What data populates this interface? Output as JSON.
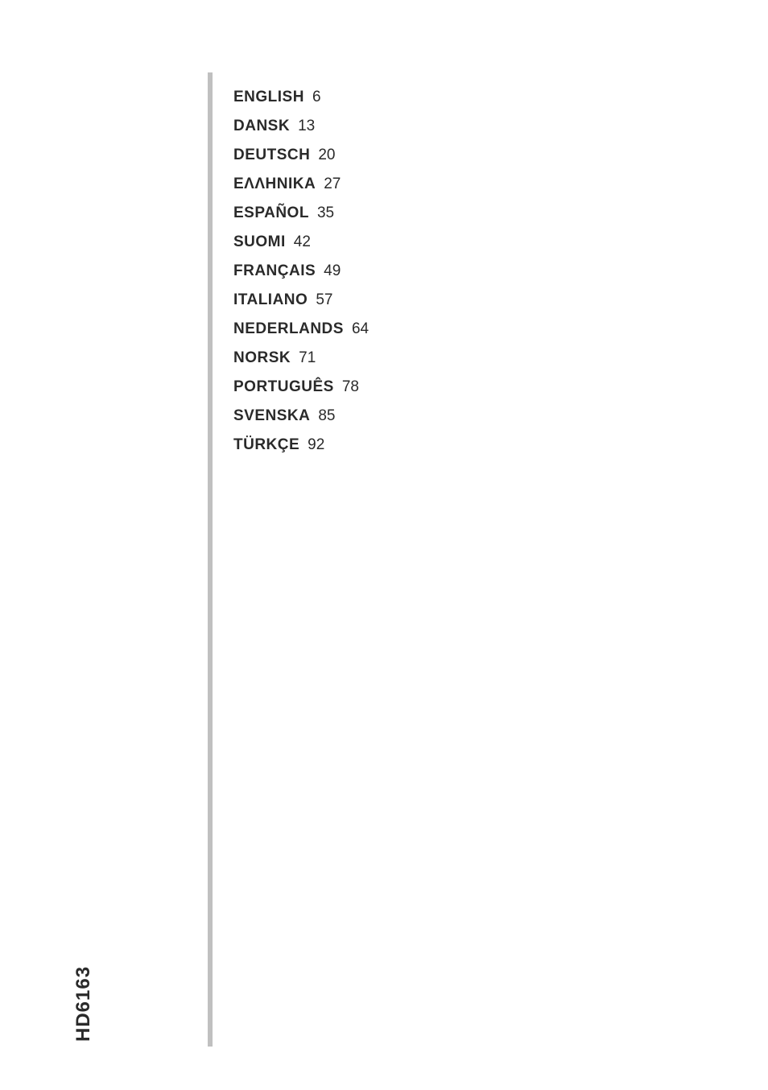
{
  "modelNumber": "HD6163",
  "languages": [
    {
      "name": "ENGLISH",
      "page": "6"
    },
    {
      "name": "DANSK",
      "page": "13"
    },
    {
      "name": "DEUTSCH",
      "page": "20"
    },
    {
      "name": "ΕΛΛΗΝΙΚΑ",
      "page": "27"
    },
    {
      "name": "ESPAÑOL",
      "page": "35"
    },
    {
      "name": "SUOMI",
      "page": "42"
    },
    {
      "name": "FRANÇAIS",
      "page": "49"
    },
    {
      "name": "ITALIANO",
      "page": "57"
    },
    {
      "name": "NEDERLANDS",
      "page": "64"
    },
    {
      "name": "NORSK",
      "page": "71"
    },
    {
      "name": "PORTUGUÊS",
      "page": "78"
    },
    {
      "name": "SVENSKA",
      "page": "85"
    },
    {
      "name": "TÜRKÇE",
      "page": "92"
    }
  ]
}
